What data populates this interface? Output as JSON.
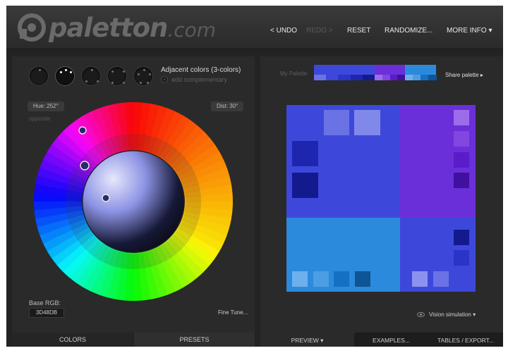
{
  "app": {
    "logo_name": "paletton",
    "logo_tld": ".com"
  },
  "nav": {
    "undo": "< UNDO",
    "redo": "REDO >",
    "reset": "RESET",
    "randomize": "RANDOMIZE...",
    "more_info": "MORE INFO ▾"
  },
  "scheme": {
    "icons": [
      "mono-scheme-icon",
      "adjacent-scheme-icon",
      "triad-scheme-icon",
      "tetrad-scheme-icon",
      "free-style-scheme-icon"
    ],
    "active_index": 1,
    "title": "Adjacent colors (3-colors)",
    "add_complementary": "add complementary"
  },
  "wheel": {
    "hue_label": "Hue: 252°",
    "dist_label": "Dist: 30°",
    "opposite_label": "opposite",
    "base_hue": 252,
    "dist": 30
  },
  "base_rgb": {
    "label": "Base RGB:",
    "value": "3D48DB"
  },
  "fine_tune": "Fine Tune...",
  "left_tabs": {
    "colors": "COLORS",
    "presets": "PRESETS"
  },
  "palette": {
    "label": "My Palette:",
    "share": "Share palette ▸"
  },
  "colors": {
    "primary": [
      "#3D48DB",
      "#6A72E6",
      "#2A34C9",
      "#1E26B0",
      "#131A8E"
    ],
    "secondary_1": [
      "#6A2FD9",
      "#9B6DEB",
      "#8247E0",
      "#5A1CC8",
      "#4010A0"
    ],
    "secondary_2": [
      "#2C8ADC",
      "#6DB0EC",
      "#4C9DE3",
      "#1570C4",
      "#0E5595"
    ],
    "background": "#232323",
    "accent": "#3D48DB"
  },
  "vision": "Vision simulation ▾",
  "right_tabs": {
    "preview": "PREVIEW ▾",
    "examples": "EXAMPLES...",
    "tables": "TABLES / EXPORT..."
  }
}
